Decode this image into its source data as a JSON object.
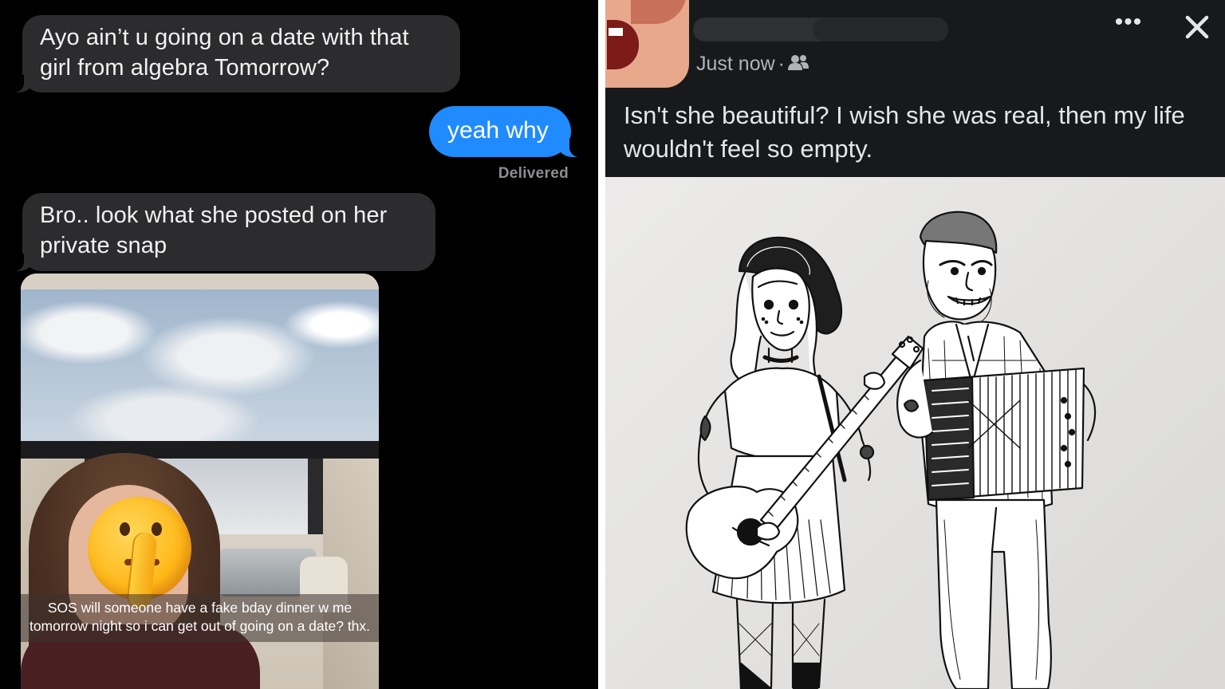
{
  "messages": {
    "incoming_1": "Ayo ain’t u going on a date with that girl from algebra Tomorrow?",
    "outgoing_1": "yeah why",
    "delivered_status": "Delivered",
    "incoming_2": "Bro.. look what she posted on her private snap"
  },
  "snap": {
    "caption": "SOS will someone have a fake bday dinner w me tomorrow night so i can get out of going on a date? thx.",
    "emoji": "shushing-face-emoji"
  },
  "post": {
    "timestamp": "Just now",
    "separator": "·",
    "audience_icon": "friends-icon",
    "more_label": "•••",
    "close_icon": "close-icon",
    "text": "Isn't she beautiful? I wish she was real, then my life wouldn't feel so empty."
  },
  "colors": {
    "imessage_bg": "#000000",
    "incoming_bubble": "#2c2c2e",
    "outgoing_bubble": "#1f8bff",
    "facebook_bg": "#18191a",
    "facebook_text": "#e4e6eb",
    "facebook_secondary": "#b0b3b8"
  }
}
